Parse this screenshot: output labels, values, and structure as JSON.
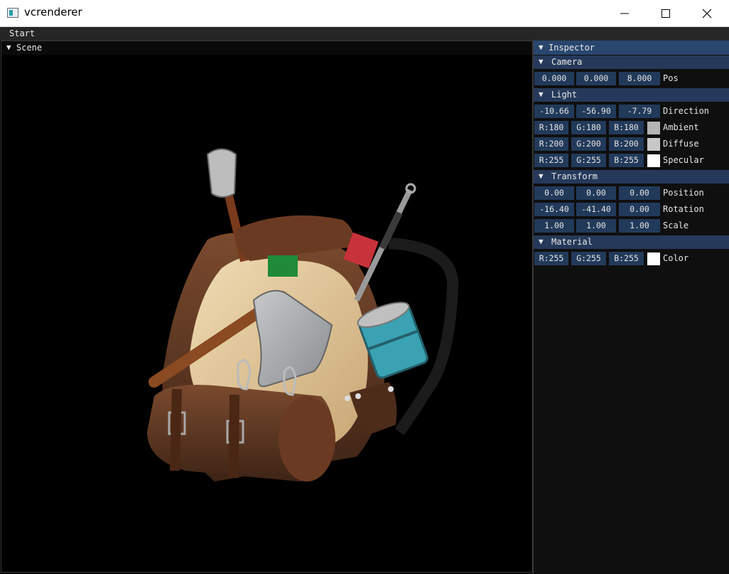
{
  "window": {
    "title": "vcrenderer"
  },
  "menu": {
    "items": [
      "Start"
    ]
  },
  "scene": {
    "title": "Scene"
  },
  "inspector": {
    "title": "Inspector",
    "camera": {
      "label": "Camera",
      "pos": [
        "0.000",
        "0.000",
        "8.000"
      ],
      "pos_label": "Pos"
    },
    "light": {
      "label": "Light",
      "direction": [
        "-10.66",
        "-56.90",
        "-7.79"
      ],
      "direction_label": "Direction",
      "ambient": [
        "R:180",
        "G:180",
        "B:180"
      ],
      "ambient_label": "Ambient",
      "ambient_color": "#b4b4b4",
      "diffuse": [
        "R:200",
        "G:200",
        "B:200"
      ],
      "diffuse_label": "Diffuse",
      "diffuse_color": "#c8c8c8",
      "specular": [
        "R:255",
        "G:255",
        "B:255"
      ],
      "specular_label": "Specular",
      "specular_color": "#ffffff"
    },
    "transform": {
      "label": "Transform",
      "position": [
        "0.00",
        "0.00",
        "0.00"
      ],
      "position_label": "Position",
      "rotation": [
        "-16.40",
        "-41.40",
        "0.00"
      ],
      "rotation_label": "Rotation",
      "scale": [
        "1.00",
        "1.00",
        "1.00"
      ],
      "scale_label": "Scale"
    },
    "material": {
      "label": "Material",
      "color": [
        "R:255",
        "G:255",
        "B:255"
      ],
      "color_label": "Color",
      "color_value": "#ffffff"
    }
  },
  "colors": {
    "header_active": "#29466e",
    "section": "#26395a",
    "field": "#223a5a"
  }
}
